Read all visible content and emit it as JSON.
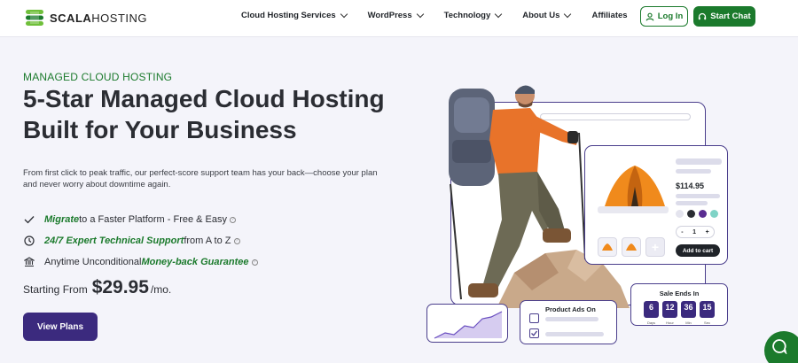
{
  "header": {
    "logo_text_bold": "SCALA",
    "logo_text_rest": "HOSTING",
    "nav": [
      {
        "label": "Cloud Hosting Services",
        "dropdown": true
      },
      {
        "label": "WordPress",
        "dropdown": true
      },
      {
        "label": "Technology",
        "dropdown": true
      },
      {
        "label": "About Us",
        "dropdown": true
      },
      {
        "label": "Affiliates",
        "dropdown": false
      }
    ],
    "login_label": "Log In",
    "chat_label": "Start Chat"
  },
  "hero": {
    "eyebrow": "MANAGED CLOUD HOSTING",
    "headline_line1": "5-Star Managed Cloud Hosting",
    "headline_line2": "Built for Your Business",
    "description": "From first click to peak traffic, our perfect-score support team has your back—choose your plan and never worry about downtime again.",
    "features": [
      {
        "icon": "check-icon",
        "highlight": "Migrate",
        "text": " to a Faster Platform - Free & Easy"
      },
      {
        "icon": "clock-icon",
        "highlight": "24/7 Expert Technical Support",
        "text": " from A to Z"
      },
      {
        "icon": "bank-icon",
        "prefix": "Anytime Unconditional ",
        "highlight": "Money-back Guarantee",
        "text": ""
      }
    ],
    "price_prefix": "Starting From",
    "price": "$29.95",
    "price_suffix": "/mo.",
    "cta_label": "View Plans"
  },
  "illustration": {
    "product_price": "$114.95",
    "quantity": "1",
    "qty_minus": "-",
    "qty_plus": "+",
    "add_to_cart": "Add to cart",
    "ads_title": "Product Ads On",
    "sale_title": "Sale Ends In",
    "countdown": [
      {
        "value": "6",
        "unit": "Days"
      },
      {
        "value": "12",
        "unit": "Hour"
      },
      {
        "value": "36",
        "unit": "Min"
      },
      {
        "value": "15",
        "unit": "Sec"
      }
    ],
    "swatch_colors": [
      "#e4e4ee",
      "#2b2d33",
      "#5a2d91",
      "#7fd3c6"
    ]
  },
  "colors": {
    "brand_green": "#1b7a2c",
    "brand_purple": "#3b2a7e"
  }
}
